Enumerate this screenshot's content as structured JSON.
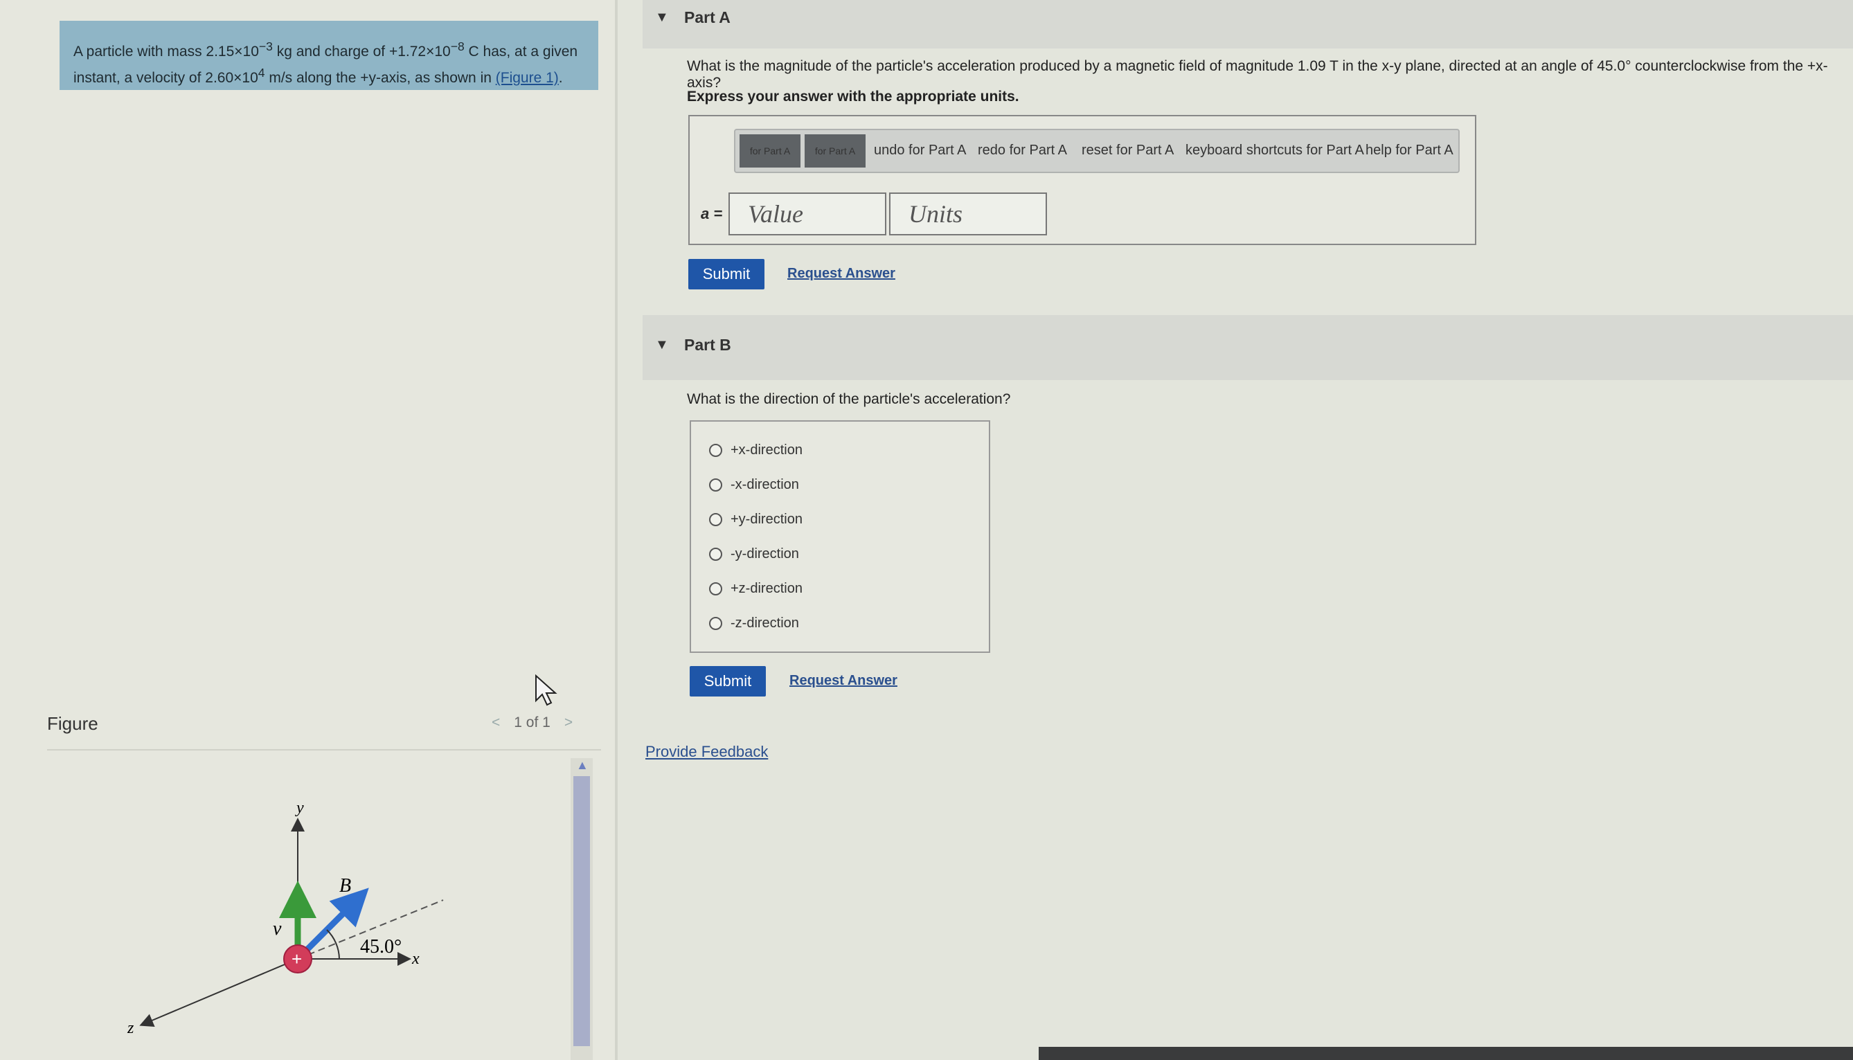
{
  "problem": {
    "text_1": "A particle with mass 2.15×10",
    "mass_exp": "−3",
    "mass_unit": " kg and charge of +1.72×10",
    "charge_exp": "−8",
    "text_2": " C has, at a given instant, a velocity of 2.60×10",
    "vel_exp": "4",
    "text_3": " m/s along the +y-axis, as shown in ",
    "link": "(Figure 1)",
    "end": "."
  },
  "figure": {
    "label": "Figure",
    "pager": "1 of 1",
    "prev": "<",
    "next": ">",
    "axis_x": "x",
    "axis_y": "y",
    "axis_z": "z",
    "vec_b": "B",
    "vec_v": "v",
    "angle": "45.0°"
  },
  "partA": {
    "title": "Part A",
    "question": "What is the magnitude of the particle's acceleration produced by a magnetic field of magnitude 1.09 T in the x-y plane, directed at an angle of 45.0° counterclockwise from the +x-axis?",
    "instruction": "Express your answer with the appropriate units.",
    "toolbar": {
      "btn1": "for Part A",
      "btn2": "for Part A",
      "undo": "undo for Part A",
      "redo": "redo for Part A",
      "reset": "reset for Part A",
      "shortcuts": "keyboard shortcuts for Part A",
      "help": "help for Part A"
    },
    "eq_label": "a =",
    "value_placeholder": "Value",
    "units_placeholder": "Units",
    "submit": "Submit",
    "request": "Request Answer"
  },
  "partB": {
    "title": "Part B",
    "question": "What is the direction of the particle's acceleration?",
    "options": [
      "+x-direction",
      "-x-direction",
      "+y-direction",
      "-y-direction",
      "+z-direction",
      "-z-direction"
    ],
    "submit": "Submit",
    "request": "Request Answer"
  },
  "feedback": "Provide Feedback",
  "colors": {
    "accent": "#1f56a8",
    "problem_bg": "#8fb5c6",
    "vector": "#2f6fcf",
    "velocity": "#3a9a3a",
    "particle": "#d23c5a"
  }
}
